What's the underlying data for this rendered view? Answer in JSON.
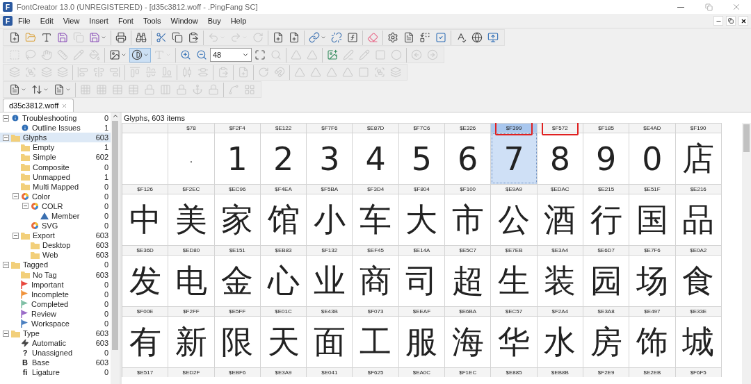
{
  "window": {
    "icon_letter": "F",
    "title": "FontCreator 13.0 (UNREGISTERED) - [d35c3812.woff - .PingFang SC]"
  },
  "menu": {
    "icon_letter": "F",
    "items": [
      "File",
      "Edit",
      "View",
      "Insert",
      "Font",
      "Tools",
      "Window",
      "Buy",
      "Help"
    ]
  },
  "toolbars": [
    [
      [
        {
          "kind": "new",
          "disabled": false
        },
        {
          "kind": "open",
          "disabled": false
        },
        {
          "kind": "text",
          "disabled": false
        },
        {
          "kind": "save",
          "disabled": false
        },
        {
          "kind": "copy",
          "disabled": true
        },
        {
          "kind": "save",
          "disabled": false,
          "dropdown": true
        }
      ],
      [
        {
          "kind": "print",
          "disabled": false
        }
      ],
      [
        {
          "kind": "find",
          "disabled": false
        }
      ],
      [
        {
          "kind": "cut",
          "disabled": false
        },
        {
          "kind": "copy",
          "disabled": false
        },
        {
          "kind": "paste",
          "disabled": false
        }
      ],
      [
        {
          "kind": "undo",
          "disabled": true,
          "dropdown": true
        },
        {
          "kind": "redo",
          "disabled": true,
          "dropdown": true
        },
        {
          "kind": "revert",
          "disabled": true
        }
      ],
      [
        {
          "kind": "new",
          "disabled": false
        },
        {
          "kind": "new",
          "disabled": false
        }
      ],
      [
        {
          "kind": "link",
          "disabled": false,
          "dropdown": true
        },
        {
          "kind": "unlink",
          "disabled": false
        },
        {
          "kind": "formula",
          "disabled": false
        }
      ],
      [
        {
          "kind": "eraser",
          "disabled": false
        }
      ],
      [
        {
          "kind": "settings",
          "disabled": false
        },
        {
          "kind": "document",
          "disabled": false
        },
        {
          "kind": "replace",
          "disabled": false
        },
        {
          "kind": "check",
          "disabled": false
        }
      ],
      [
        {
          "kind": "spell",
          "disabled": false
        },
        {
          "kind": "globe",
          "disabled": false
        },
        {
          "kind": "upload",
          "disabled": false
        }
      ]
    ],
    [
      [
        {
          "kind": "select",
          "disabled": true
        },
        {
          "kind": "lasso",
          "disabled": true
        },
        {
          "kind": "hand",
          "disabled": true
        },
        {
          "kind": "ruler",
          "disabled": true
        },
        {
          "kind": "pencil",
          "disabled": true
        },
        {
          "kind": "bucket",
          "disabled": true
        }
      ],
      [
        {
          "kind": "image",
          "disabled": false,
          "dropdown": true
        },
        {
          "kind": "contrast",
          "disabled": false,
          "dropdown": true,
          "pressed": true
        },
        {
          "kind": "text",
          "disabled": true,
          "dropdown": true
        }
      ],
      [
        {
          "kind": "zoom-in",
          "disabled": false
        },
        {
          "kind": "zoom-out",
          "disabled": false
        },
        {
          "kind": "zoom-field",
          "disabled": false,
          "value": "48"
        },
        {
          "kind": "fit",
          "disabled": false
        },
        {
          "kind": "search",
          "disabled": true
        }
      ],
      [
        {
          "kind": "triangle",
          "disabled": true
        },
        {
          "kind": "triangle",
          "disabled": true
        }
      ],
      [
        {
          "kind": "image-add",
          "disabled": false
        },
        {
          "kind": "pen",
          "disabled": true
        },
        {
          "kind": "pencil",
          "disabled": true
        },
        {
          "kind": "square",
          "disabled": true
        },
        {
          "kind": "circle",
          "disabled": true
        }
      ],
      [
        {
          "kind": "back",
          "disabled": true
        },
        {
          "kind": "forward",
          "disabled": true
        }
      ]
    ],
    [
      [
        {
          "kind": "layers",
          "disabled": true
        },
        {
          "kind": "group",
          "disabled": true
        },
        {
          "kind": "layers",
          "disabled": true
        },
        {
          "kind": "layers",
          "disabled": true
        }
      ],
      [
        {
          "kind": "align-left",
          "disabled": true
        },
        {
          "kind": "align-center",
          "disabled": true
        },
        {
          "kind": "align-right",
          "disabled": true
        }
      ],
      [
        {
          "kind": "align-top",
          "disabled": true
        },
        {
          "kind": "align-middle",
          "disabled": true
        },
        {
          "kind": "align-bottom",
          "disabled": true
        }
      ],
      [
        {
          "kind": "distribute-h",
          "disabled": true
        },
        {
          "kind": "distribute-v",
          "disabled": true
        }
      ],
      [
        {
          "kind": "paste",
          "disabled": true
        }
      ],
      [
        {
          "kind": "new",
          "disabled": true
        }
      ],
      [
        {
          "kind": "revert",
          "disabled": true
        },
        {
          "kind": "magnet",
          "disabled": true
        }
      ],
      [
        {
          "kind": "triangle",
          "disabled": true
        },
        {
          "kind": "triangle",
          "disabled": true
        },
        {
          "kind": "triangle",
          "disabled": true
        },
        {
          "kind": "triangle",
          "disabled": true
        },
        {
          "kind": "square",
          "disabled": true
        },
        {
          "kind": "group",
          "disabled": true
        },
        {
          "kind": "layers",
          "disabled": true
        }
      ]
    ],
    [
      [
        {
          "kind": "document",
          "disabled": false,
          "dropdown": true
        },
        {
          "kind": "sort",
          "disabled": false,
          "dropdown": true
        },
        {
          "kind": "document",
          "disabled": false,
          "dropdown": true
        }
      ],
      [
        {
          "kind": "grid",
          "disabled": true
        },
        {
          "kind": "grid",
          "disabled": true
        },
        {
          "kind": "table",
          "disabled": true
        },
        {
          "kind": "table",
          "disabled": true
        },
        {
          "kind": "lock",
          "disabled": true
        },
        {
          "kind": "columns",
          "disabled": true
        },
        {
          "kind": "lock",
          "disabled": true
        },
        {
          "kind": "anchor",
          "disabled": true
        },
        {
          "kind": "lock",
          "disabled": true
        }
      ],
      [
        {
          "kind": "nodes",
          "disabled": true
        },
        {
          "kind": "grid-small",
          "disabled": true
        }
      ]
    ]
  ],
  "document_tab": {
    "label": "d35c3812.woff",
    "selected": true
  },
  "tree": [
    {
      "label": "Troubleshooting",
      "count": "0",
      "kind": "info",
      "selected": false,
      "expanded": true,
      "children": [
        {
          "label": "Outline Issues",
          "count": "1",
          "kind": "info",
          "selected": false
        }
      ]
    },
    {
      "label": "Glyphs",
      "count": "603",
      "kind": "folder",
      "selected": true,
      "expanded": true,
      "children": [
        {
          "label": "Empty",
          "count": "1",
          "kind": "folder",
          "selected": false
        },
        {
          "label": "Simple",
          "count": "602",
          "kind": "folder",
          "selected": false
        },
        {
          "label": "Composite",
          "count": "0",
          "kind": "folder",
          "selected": false
        },
        {
          "label": "Unmapped",
          "count": "1",
          "kind": "folder",
          "selected": false
        },
        {
          "label": "Multi Mapped",
          "count": "0",
          "kind": "folder",
          "selected": false
        },
        {
          "label": "Color",
          "count": "0",
          "kind": "palette",
          "selected": false,
          "expanded": true,
          "children": [
            {
              "label": "COLR",
              "count": "0",
              "kind": "palette",
              "selected": false,
              "expanded": true,
              "children": [
                {
                  "label": "Member",
                  "count": "0",
                  "kind": "triangle",
                  "selected": false
                }
              ]
            },
            {
              "label": "SVG",
              "count": "0",
              "kind": "palette",
              "selected": false
            }
          ]
        },
        {
          "label": "Export",
          "count": "603",
          "kind": "folder",
          "selected": false,
          "expanded": true,
          "children": [
            {
              "label": "Desktop",
              "count": "603",
              "kind": "folder",
              "selected": false
            },
            {
              "label": "Web",
              "count": "603",
              "kind": "folder",
              "selected": false
            }
          ]
        }
      ]
    },
    {
      "label": "Tagged",
      "count": "0",
      "kind": "folder",
      "selected": false,
      "expanded": true,
      "children": [
        {
          "label": "No Tag",
          "count": "603",
          "kind": "folder",
          "selected": false
        },
        {
          "label": "Important",
          "count": "0",
          "kind": "flag",
          "color": "#e8463c",
          "selected": false
        },
        {
          "label": "Incomplete",
          "count": "0",
          "kind": "flag",
          "color": "#f0923a",
          "selected": false
        },
        {
          "label": "Completed",
          "count": "0",
          "kind": "flag",
          "color": "#7fbfa5",
          "selected": false
        },
        {
          "label": "Review",
          "count": "0",
          "kind": "flag",
          "color": "#9b6cc8",
          "selected": false
        },
        {
          "label": "Workspace",
          "count": "0",
          "kind": "flag",
          "color": "#4a7fc0",
          "selected": false
        }
      ]
    },
    {
      "label": "Type",
      "count": "603",
      "kind": "folder",
      "selected": false,
      "expanded": true,
      "children": [
        {
          "label": "Automatic",
          "count": "603",
          "kind": "bolt",
          "selected": false
        },
        {
          "label": "Unassigned",
          "count": "0",
          "kind": "glyph",
          "glyph": "?",
          "selected": false
        },
        {
          "label": "Base",
          "count": "603",
          "kind": "glyph",
          "glyph": "B",
          "selected": false
        },
        {
          "label": "Ligature",
          "count": "0",
          "kind": "glyph",
          "glyph": "fi",
          "selected": false
        }
      ]
    }
  ],
  "glyph_panel": {
    "caption": "Glyphs, 603 items",
    "rows": [
      {
        "cells": [
          {
            "selected": false,
            "highlighted": false
          },
          {
            "code": "$78",
            "glyph": ".",
            "selected": false,
            "highlighted": false
          },
          {
            "code": "$F2F4",
            "glyph": "1",
            "selected": false,
            "highlighted": false
          },
          {
            "code": "$E122",
            "glyph": "2",
            "selected": false,
            "highlighted": false
          },
          {
            "code": "$F7F6",
            "glyph": "3",
            "selected": false,
            "highlighted": false
          },
          {
            "code": "$E87D",
            "glyph": "4",
            "selected": false,
            "highlighted": false
          },
          {
            "code": "$F7C6",
            "glyph": "5",
            "selected": false,
            "highlighted": false
          },
          {
            "code": "$E326",
            "glyph": "6",
            "selected": false,
            "highlighted": false
          },
          {
            "code": "$F399",
            "glyph": "7",
            "selected": true,
            "highlighted": true
          },
          {
            "code": "$F572",
            "glyph": "8",
            "selected": false,
            "highlighted": true
          },
          {
            "code": "$F185",
            "glyph": "9",
            "selected": false,
            "highlighted": false
          },
          {
            "code": "$E4AD",
            "glyph": "0",
            "selected": false,
            "highlighted": false
          },
          {
            "code": "$F190",
            "glyph": "店",
            "selected": false,
            "highlighted": false
          }
        ]
      },
      {
        "cells": [
          {
            "code": "$F126",
            "glyph": "中",
            "selected": false,
            "highlighted": false
          },
          {
            "code": "$F2EC",
            "glyph": "美",
            "selected": false,
            "highlighted": false
          },
          {
            "code": "$EC96",
            "glyph": "家",
            "selected": false,
            "highlighted": false
          },
          {
            "code": "$F4EA",
            "glyph": "馆",
            "selected": false,
            "highlighted": false
          },
          {
            "code": "$F5BA",
            "glyph": "小",
            "selected": false,
            "highlighted": false
          },
          {
            "code": "$F3D4",
            "glyph": "车",
            "selected": false,
            "highlighted": false
          },
          {
            "code": "$F804",
            "glyph": "大",
            "selected": false,
            "highlighted": false
          },
          {
            "code": "$F100",
            "glyph": "市",
            "selected": false,
            "highlighted": false
          },
          {
            "code": "$E9A9",
            "glyph": "公",
            "selected": false,
            "highlighted": false
          },
          {
            "code": "$EDAC",
            "glyph": "酒",
            "selected": false,
            "highlighted": false
          },
          {
            "code": "$E215",
            "glyph": "行",
            "selected": false,
            "highlighted": false
          },
          {
            "code": "$E51F",
            "glyph": "国",
            "selected": false,
            "highlighted": false
          },
          {
            "code": "$E216",
            "glyph": "品",
            "selected": false,
            "highlighted": false
          }
        ]
      },
      {
        "cells": [
          {
            "code": "$E36D",
            "glyph": "发",
            "selected": false,
            "highlighted": false
          },
          {
            "code": "$ED80",
            "glyph": "电",
            "selected": false,
            "highlighted": false
          },
          {
            "code": "$E151",
            "glyph": "金",
            "selected": false,
            "highlighted": false
          },
          {
            "code": "$EB83",
            "glyph": "心",
            "selected": false,
            "highlighted": false
          },
          {
            "code": "$F132",
            "glyph": "业",
            "selected": false,
            "highlighted": false
          },
          {
            "code": "$EF45",
            "glyph": "商",
            "selected": false,
            "highlighted": false
          },
          {
            "code": "$E14A",
            "glyph": "司",
            "selected": false,
            "highlighted": false
          },
          {
            "code": "$E5C7",
            "glyph": "超",
            "selected": false,
            "highlighted": false
          },
          {
            "code": "$E7EB",
            "glyph": "生",
            "selected": false,
            "highlighted": false
          },
          {
            "code": "$E3A4",
            "glyph": "装",
            "selected": false,
            "highlighted": false
          },
          {
            "code": "$E6D7",
            "glyph": "园",
            "selected": false,
            "highlighted": false
          },
          {
            "code": "$E7F6",
            "glyph": "场",
            "selected": false,
            "highlighted": false
          },
          {
            "code": "$E0A2",
            "glyph": "食",
            "selected": false,
            "highlighted": false
          }
        ]
      },
      {
        "cells": [
          {
            "code": "$F00E",
            "glyph": "有",
            "selected": false,
            "highlighted": false
          },
          {
            "code": "$F2FF",
            "glyph": "新",
            "selected": false,
            "highlighted": false
          },
          {
            "code": "$E5FF",
            "glyph": "限",
            "selected": false,
            "highlighted": false
          },
          {
            "code": "$E01C",
            "glyph": "天",
            "selected": false,
            "highlighted": false
          },
          {
            "code": "$E43B",
            "glyph": "面",
            "selected": false,
            "highlighted": false
          },
          {
            "code": "$F073",
            "glyph": "工",
            "selected": false,
            "highlighted": false
          },
          {
            "code": "$EEAF",
            "glyph": "服",
            "selected": false,
            "highlighted": false
          },
          {
            "code": "$E6BA",
            "glyph": "海",
            "selected": false,
            "highlighted": false
          },
          {
            "code": "$EC57",
            "glyph": "华",
            "selected": false,
            "highlighted": false
          },
          {
            "code": "$F2A4",
            "glyph": "水",
            "selected": false,
            "highlighted": false
          },
          {
            "code": "$E3A8",
            "glyph": "房",
            "selected": false,
            "highlighted": false
          },
          {
            "code": "$E497",
            "glyph": "饰",
            "selected": false,
            "highlighted": false
          },
          {
            "code": "$E33E",
            "glyph": "城",
            "selected": false,
            "highlighted": false
          }
        ]
      },
      {
        "cells": [
          {
            "code": "$E517",
            "selected": false,
            "highlighted": false
          },
          {
            "code": "$ED2F",
            "selected": false,
            "highlighted": false
          },
          {
            "code": "$EBF6",
            "selected": false,
            "highlighted": false
          },
          {
            "code": "$E3A9",
            "selected": false,
            "highlighted": false
          },
          {
            "code": "$E041",
            "selected": false,
            "highlighted": false
          },
          {
            "code": "$F625",
            "selected": false,
            "highlighted": false
          },
          {
            "code": "$EA0C",
            "selected": false,
            "highlighted": false
          },
          {
            "code": "$F1EC",
            "selected": false,
            "highlighted": false
          },
          {
            "code": "$E885",
            "selected": false,
            "highlighted": false
          },
          {
            "code": "$EB8B",
            "selected": false,
            "highlighted": false
          },
          {
            "code": "$F2E9",
            "selected": false,
            "highlighted": false
          },
          {
            "code": "$E2EB",
            "selected": false,
            "highlighted": false
          },
          {
            "code": "$F6F5",
            "selected": false,
            "highlighted": false
          }
        ]
      }
    ]
  }
}
